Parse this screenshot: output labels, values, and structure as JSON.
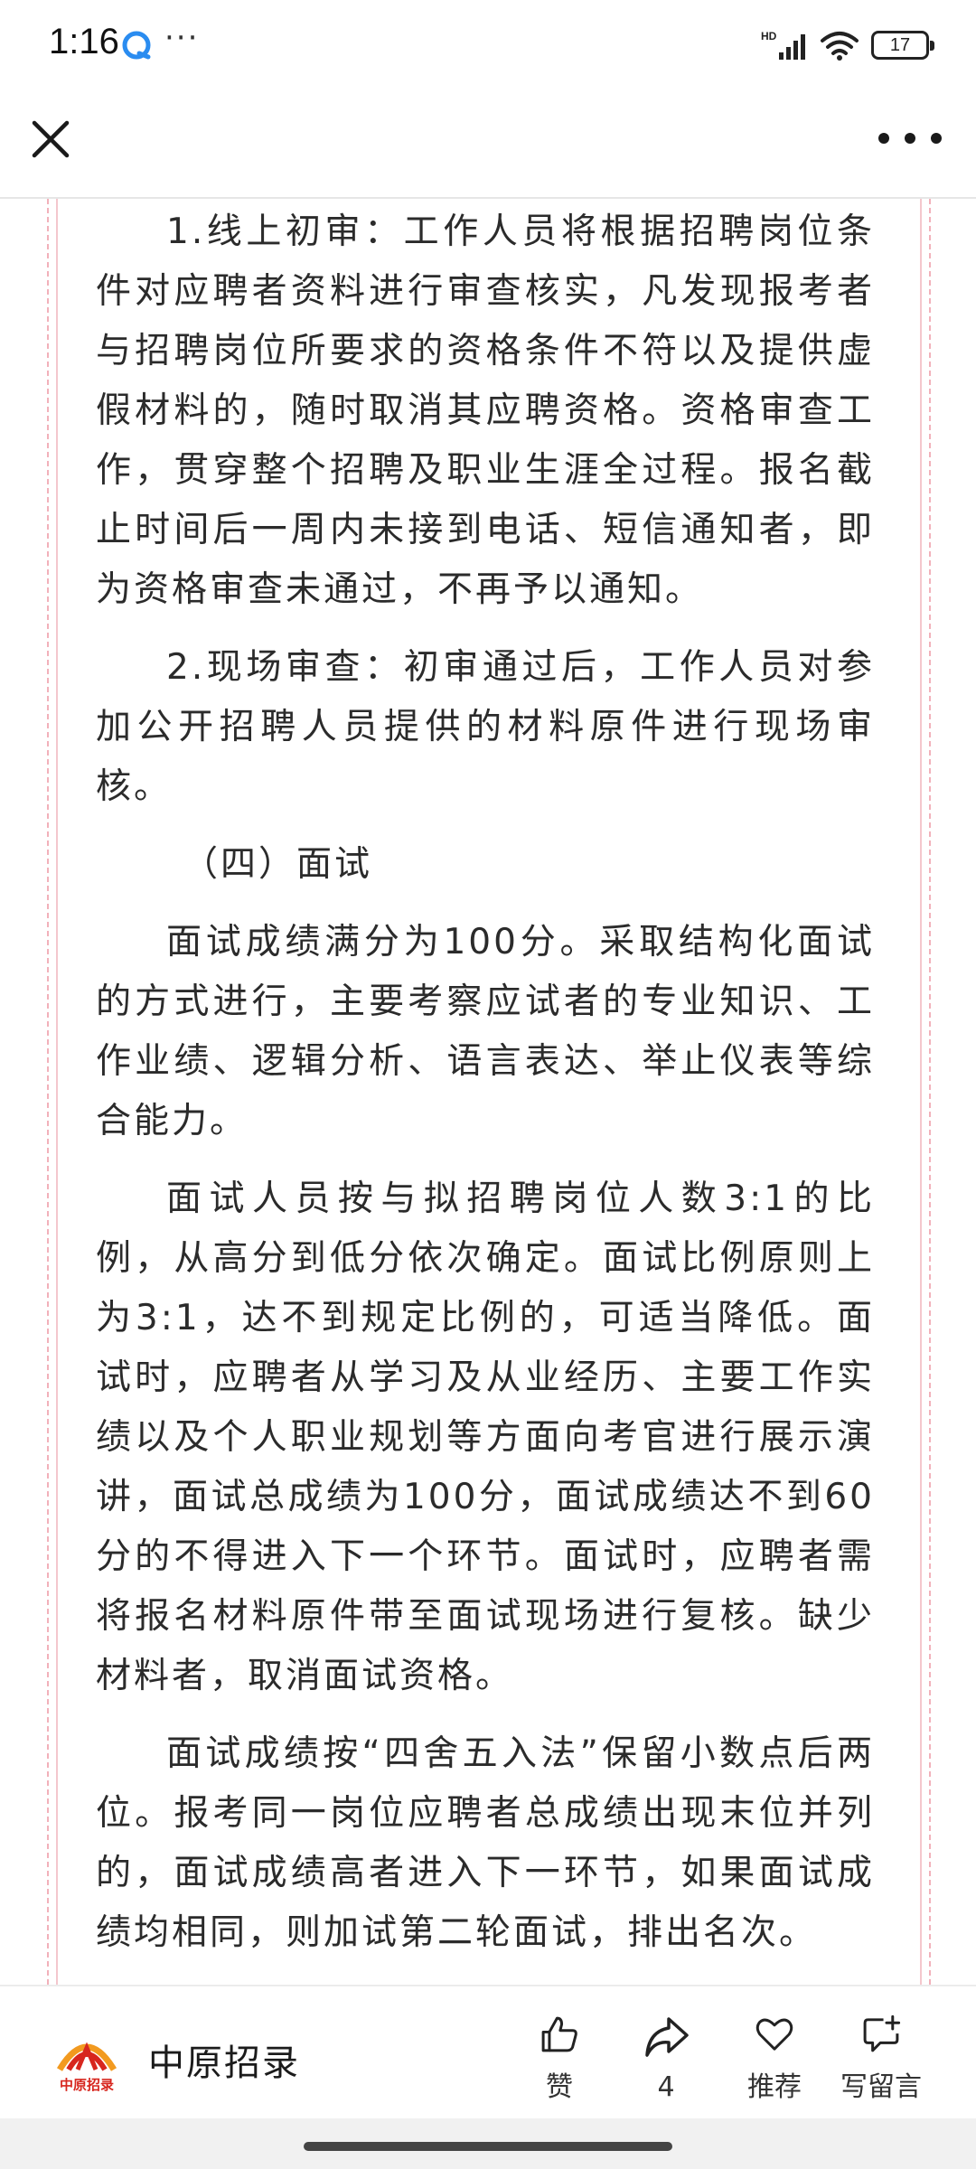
{
  "status_bar": {
    "time": "1:16",
    "dots": "···",
    "network": "HD",
    "battery": "17"
  },
  "icons": {
    "close": "close-icon",
    "more": "more-icon",
    "like": "thumbs-up-icon",
    "share": "share-icon",
    "recommend": "heart-icon",
    "comment": "comment-add-icon"
  },
  "colors": {
    "accent_red": "#d7261e",
    "accent_orange": "#f29a1f",
    "frame_pink": "#f2b1ba"
  },
  "article": {
    "paragraphs": [
      "1.线上初审：工作人员将根据招聘岗位条件对应聘者资料进行审查核实，凡发现报考者与招聘岗位所要求的资格条件不符以及提供虚假材料的，随时取消其应聘资格。资格审查工作，贯穿整个招聘及职业生涯全过程。报名截止时间后一周内未接到电话、短信通知者，即为资格审查未通过，不再予以通知。",
      "2.现场审查：初审通过后，工作人员对参加公开招聘人员提供的材料原件进行现场审核。",
      "（四）面试",
      "面试成绩满分为100分。采取结构化面试的方式进行，主要考察应试者的专业知识、工作业绩、逻辑分析、语言表达、举止仪表等综合能力。",
      "面试人员按与拟招聘岗位人数3:1的比例，从高分到低分依次确定。面试比例原则上为3:1，达不到规定比例的，可适当降低。面试时，应聘者从学习及从业经历、主要工作实绩以及个人职业规划等方面向考官进行展示演讲，面试总成绩为100分，面试成绩达不到60分的不得进入下一个环节。面试时，应聘者需将报名材料原件带至面试现场进行复核。缺少材料者，取消面试资格。",
      "面试成绩按“四舍五入法”保留小数点后两位。报考同一岗位应聘者总成绩出现末位并列的，面试成绩高者进入下一环节，如果面试成绩均相同，则加试第二轮面试，排出名次。"
    ]
  },
  "bottom_bar": {
    "account_name": "中原招录",
    "logo_text": "中原招录",
    "like_label": "赞",
    "share_count": "4",
    "recommend_label": "推荐",
    "comment_label": "写留言"
  }
}
